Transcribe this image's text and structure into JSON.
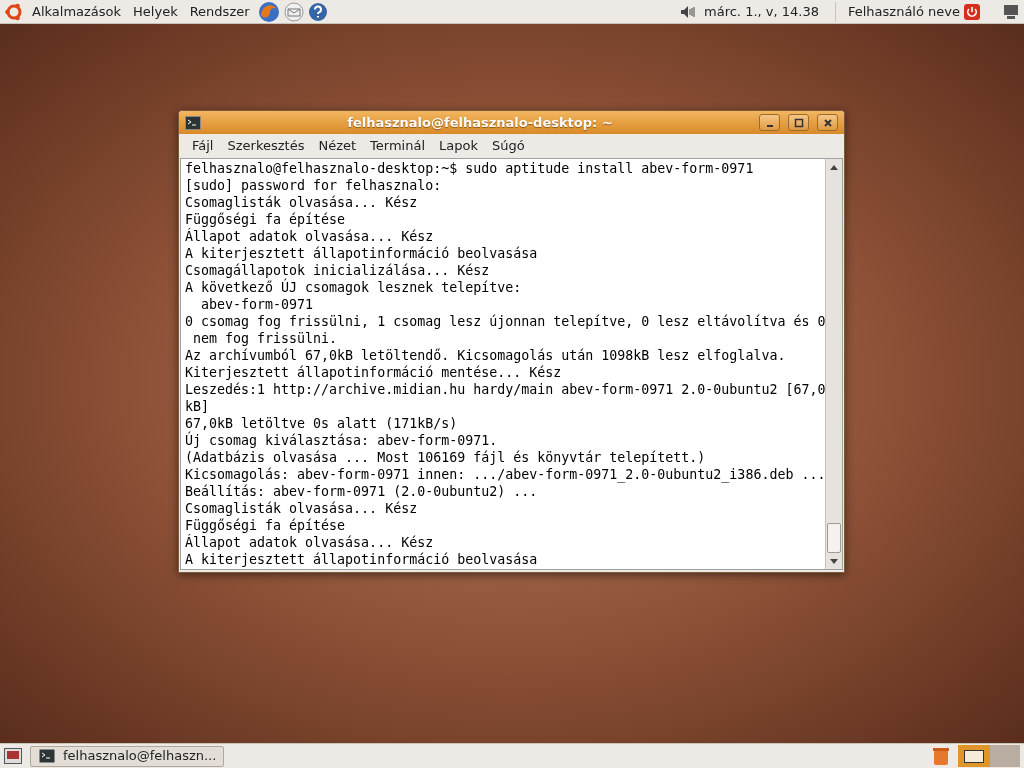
{
  "top_panel": {
    "menus": [
      "Alkalmazások",
      "Helyek",
      "Rendszer"
    ],
    "clock": "márc. 1., v, 14.38",
    "user": "Felhasználó neve"
  },
  "window": {
    "title": "felhasznalo@felhasznalo-desktop: ~",
    "menu": [
      "Fájl",
      "Szerkesztés",
      "Nézet",
      "Terminál",
      "Lapok",
      "Súgó"
    ],
    "lines": [
      "felhasznalo@felhasznalo-desktop:~$ sudo aptitude install abev-form-0971",
      "[sudo] password for felhasznalo:",
      "Csomaglisták olvasása... Kész",
      "Függőségi fa építése",
      "Állapot adatok olvasása... Kész",
      "A kiterjesztett állapotinformáció beolvasása",
      "Csomagállapotok inicializálása... Kész",
      "A következő ÚJ csomagok lesznek telepítve:",
      "  abev-form-0971",
      "0 csomag fog frissülni, 1 csomag lesz újonnan telepítve, 0 lesz eltávolítva és 0",
      " nem fog frissülni.",
      "Az archívumból 67,0kB letöltendő. Kicsomagolás után 1098kB lesz elfoglalva.",
      "Kiterjesztett állapotinformáció mentése... Kész",
      "Leszedés:1 http://archive.midian.hu hardy/main abev-form-0971 2.0-0ubuntu2 [67,0",
      "kB]",
      "67,0kB letöltve 0s alatt (171kB/s)",
      "Új csomag kiválasztása: abev-form-0971.",
      "(Adatbázis olvasása ... Most 106169 fájl és könyvtár telepített.)",
      "Kicsomagolás: abev-form-0971 innen: .../abev-form-0971_2.0-0ubuntu2_i386.deb ...",
      "Beállítás: abev-form-0971 (2.0-0ubuntu2) ...",
      "Csomaglisták olvasása... Kész",
      "Függőségi fa építése",
      "Állapot adatok olvasása... Kész",
      "A kiterjesztett állapotinformáció beolvasása"
    ]
  },
  "bottom_panel": {
    "tasks": [
      {
        "label": "felhasznalo@felhaszn...",
        "selected": false
      }
    ]
  }
}
